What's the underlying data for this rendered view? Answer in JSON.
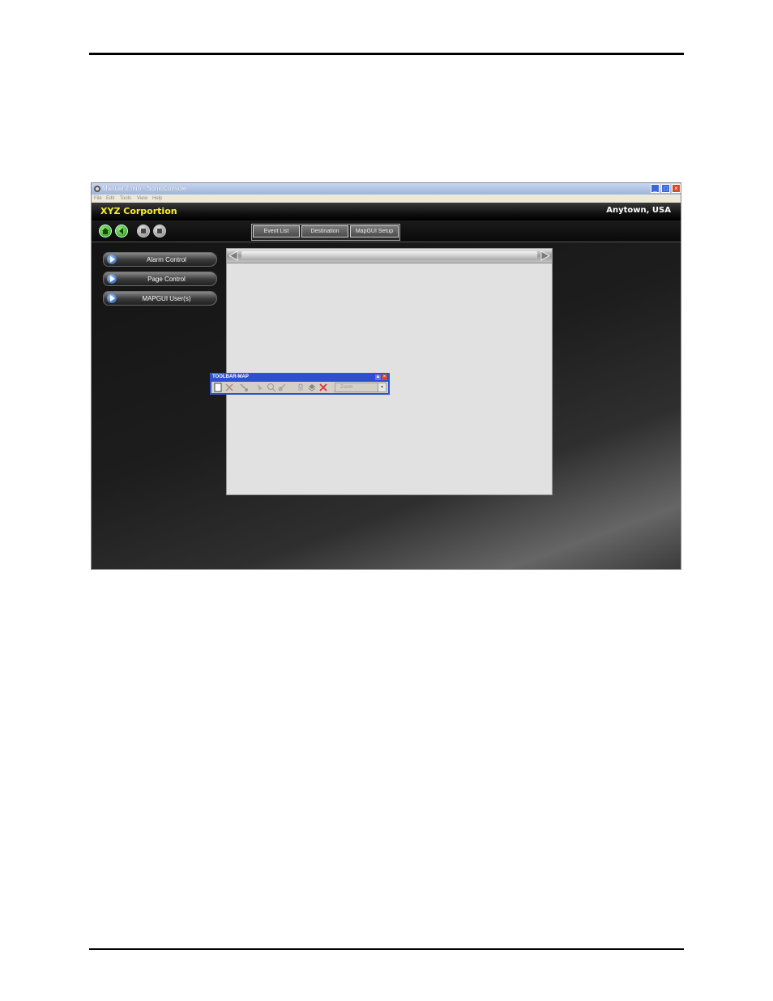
{
  "window": {
    "title": "Manual 2.mio - SonicConsole",
    "controls": {
      "minimize": "_",
      "maximize": "□",
      "close": "×"
    }
  },
  "menu": [
    "File",
    "Edit",
    "Tools",
    "View",
    "Help"
  ],
  "header": {
    "company": "XYZ Corportion",
    "location": "Anytown, USA"
  },
  "tabs": [
    "Event List",
    "Destination",
    "MapGUI Setup"
  ],
  "sidebar": {
    "items": [
      {
        "label": "Alarm Control"
      },
      {
        "label": "Page Control"
      },
      {
        "label": "MAPGUI User(s)"
      }
    ]
  },
  "toolbar_map": {
    "title": "TOOLBAR-MAP",
    "zoom_value": "Zoom",
    "pin": "▲",
    "close": "×"
  },
  "colors": {
    "company_text": "#f6ef2b",
    "header_bg": "#000000",
    "map_canvas": "#e1e1e1",
    "toolbar_title_bg": "#2f4fd0"
  },
  "icons": [
    "app-icon",
    "home-icon",
    "back-icon",
    "stop-icon",
    "play-icon",
    "scroll-left-icon",
    "scroll-right-icon",
    "new-icon",
    "delete-icon",
    "move-icon",
    "pointer-icon",
    "zoom-icon",
    "link-icon",
    "lock-icon",
    "layer-icon",
    "remove-icon"
  ]
}
